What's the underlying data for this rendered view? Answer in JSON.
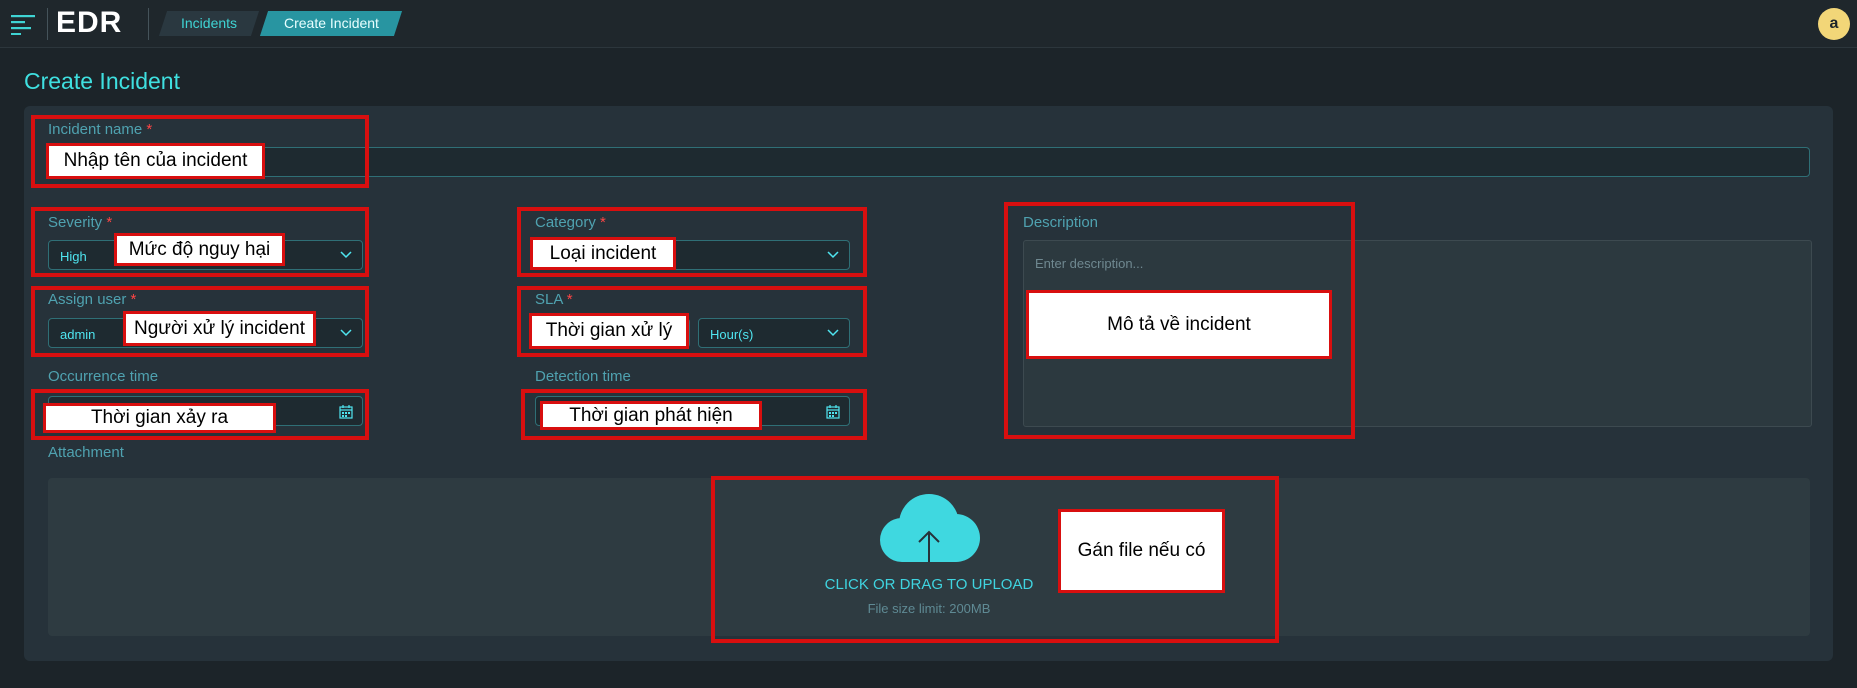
{
  "topbar": {
    "logo": "EDR",
    "breadcrumbs": [
      "Incidents",
      "Create Incident"
    ],
    "avatar_letter": "a"
  },
  "page": {
    "title": "Create Incident"
  },
  "form": {
    "incident_name": {
      "label": "Incident name",
      "required_mark": "*"
    },
    "severity": {
      "label": "Severity",
      "required_mark": "*",
      "value": "High"
    },
    "category": {
      "label": "Category",
      "required_mark": "*"
    },
    "assign_user": {
      "label": "Assign user",
      "required_mark": "*",
      "value": "admin"
    },
    "sla": {
      "label": "SLA",
      "required_mark": "*",
      "unit_value": "Hour(s)"
    },
    "occurrence_time": {
      "label": "Occurrence time"
    },
    "detection_time": {
      "label": "Detection time"
    },
    "description": {
      "label": "Description",
      "placeholder": "Enter description..."
    },
    "attachment": {
      "label": "Attachment",
      "upload_text": "CLICK OR DRAG TO UPLOAD",
      "size_limit": "File size limit: 200MB"
    }
  },
  "annotations": {
    "incident_name": "Nhập tên của incident",
    "severity": "Mức độ nguy hại",
    "category": "Loại incident",
    "assign_user": "Người xử lý incident",
    "sla": "Thời gian xử lý",
    "occurrence_time": "Thời gian xảy ra",
    "detection_time": "Thời gian phát hiện",
    "description": "Mô tả về incident",
    "attachment": "Gán file nếu có"
  },
  "colors": {
    "background": "#1c2429",
    "accent": "#3fe0e0",
    "annotation_border": "#d80f0f",
    "avatar": "#f2d678"
  },
  "icons": [
    "menu-icon",
    "chevron-down-icon",
    "calendar-icon",
    "cloud-upload-icon"
  ]
}
